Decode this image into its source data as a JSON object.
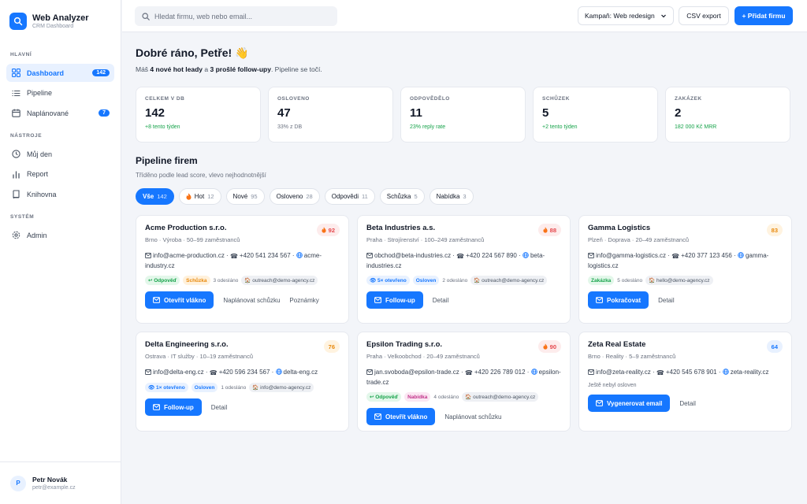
{
  "brand": {
    "title": "Web Analyzer",
    "subtitle": "CRM Dashboard"
  },
  "sidebar": {
    "sections": [
      {
        "title": "HLAVNÍ"
      },
      {
        "title": "NÁSTROJE"
      },
      {
        "title": "SYSTÉM"
      }
    ],
    "items": [
      {
        "label": "Dashboard",
        "icon": "grid-icon",
        "badge": "142"
      },
      {
        "label": "Pipeline",
        "icon": "list-icon"
      },
      {
        "label": "Naplánované",
        "icon": "calendar-icon",
        "badge": "7"
      },
      {
        "label": "Můj den",
        "icon": "clock-icon"
      },
      {
        "label": "Report",
        "icon": "bar-chart-icon"
      },
      {
        "label": "Knihovna",
        "icon": "book-icon"
      },
      {
        "label": "Admin",
        "icon": "gear-icon"
      }
    ]
  },
  "user": {
    "initial": "P",
    "name": "Petr Novák",
    "email": "petr@example.cz"
  },
  "topbar": {
    "search_placeholder": "Hledat firmu, web nebo email...",
    "campaign": "Kampaň: Web redesign",
    "csv_label": "CSV export",
    "add_label": "+ Přidat firmu"
  },
  "greeting": {
    "title": "Dobré ráno, Petře! 👋",
    "sub_prefix": "Máš ",
    "sub_hot": "4 nové hot leady",
    "sub_mid": " a ",
    "sub_follow": "3 prošlé follow-upy",
    "sub_suffix": ". Pipeline se točí."
  },
  "stats": [
    {
      "label": "CELKEM V DB",
      "value": "142",
      "note": "+8 tento týden",
      "note_color": "green"
    },
    {
      "label": "OSLOVENO",
      "value": "47",
      "note": "33% z DB",
      "note_color": "gray"
    },
    {
      "label": "ODPOVĚDĚLO",
      "value": "11",
      "note": "23% reply rate",
      "note_color": "green"
    },
    {
      "label": "SCHŮZEK",
      "value": "5",
      "note": "+2 tento týden",
      "note_color": "green"
    },
    {
      "label": "ZAKÁZEK",
      "value": "2",
      "note": "182 000 Kč MRR",
      "note_color": "green"
    }
  ],
  "pipeline": {
    "title": "Pipeline firem",
    "subtitle": "Tříděno podle lead score, vlevo nejhodnotnější",
    "filters": [
      {
        "label": "Vše",
        "count": "142"
      },
      {
        "label": "Hot",
        "count": "12"
      },
      {
        "label": "Nové",
        "count": "95"
      },
      {
        "label": "Osloveno",
        "count": "28"
      },
      {
        "label": "Odpovědi",
        "count": "11"
      },
      {
        "label": "Schůzka",
        "count": "5"
      },
      {
        "label": "Nabídka",
        "count": "3"
      }
    ]
  },
  "cards": [
    {
      "name": "Acme Production s.r.o.",
      "meta": "Brno · Výroba · 50–99 zaměstnanců",
      "score": "92",
      "email": "info@acme-production.cz",
      "phone": "+420 541 234 567",
      "web": "acme-industry.cz",
      "tags": [
        "↩ Odpověď",
        "Schůzka"
      ],
      "sent": "3 odesláno",
      "sender": "outreach@demo-agency.cz",
      "primary": "Otevřít vlákno",
      "links": [
        "Naplánovat schůzku",
        "Poznámky"
      ]
    },
    {
      "name": "Beta Industries a.s.",
      "meta": "Praha · Strojírenství · 100–249 zaměstnanců",
      "score": "88",
      "email": "obchod@beta-industries.cz",
      "phone": "+420 224 567 890",
      "web": "beta-industries.cz",
      "tags": [
        "👁 5× otevřeno",
        "Osloven"
      ],
      "sent": "2 odesláno",
      "sender": "outreach@demo-agency.cz",
      "primary": "Follow-up",
      "links": [
        "Detail"
      ]
    },
    {
      "name": "Gamma Logistics",
      "meta": "Plzeň · Doprava · 20–49 zaměstnanců",
      "score": "83",
      "email": "info@gamma-logistics.cz",
      "phone": "+420 377 123 456",
      "web": "gamma-logistics.cz",
      "tags": [
        "Zakázka"
      ],
      "sent": "5 odesláno",
      "sender": "hello@demo-agency.cz",
      "primary": "Pokračovat",
      "links": [
        "Detail"
      ]
    },
    {
      "name": "Delta Engineering s.r.o.",
      "meta": "Ostrava · IT služby · 10–19 zaměstnanců",
      "score": "76",
      "email": "info@delta-eng.cz",
      "phone": "+420 596 234 567",
      "web": "delta-eng.cz",
      "tags": [
        "👁 1× otevřeno",
        "Osloven"
      ],
      "sent": "1 odesláno",
      "sender": "info@demo-agency.cz",
      "primary": "Follow-up",
      "links": [
        "Detail"
      ]
    },
    {
      "name": "Epsilon Trading s.r.o.",
      "meta": "Praha · Velkoobchod · 20–49 zaměstnanců",
      "score": "90",
      "email": "jan.svoboda@epsilon-trade.cz",
      "phone": "+420 226 789 012",
      "web": "epsilon-trade.cz",
      "tags": [
        "↩ Odpověď",
        "Nabídka"
      ],
      "sent": "4 odesláno",
      "sender": "outreach@demo-agency.cz",
      "primary": "Otevřít vlákno",
      "links": [
        "Naplánovat schůzku"
      ]
    },
    {
      "name": "Zeta Real Estate",
      "meta": "Brno · Reality · 5–9 zaměstnanců",
      "score": "64",
      "email": "info@zeta-reality.cz",
      "phone": "+420 545 678 901",
      "web": "zeta-reality.cz",
      "note": "Ještě nebyl osloven",
      "primary": "Vygenerovat email",
      "links": [
        "Detail"
      ]
    }
  ],
  "colors": {
    "accent": "#1677ff",
    "hot": "#e5484d",
    "warm": "#e8890c",
    "success": "#16a34a"
  }
}
